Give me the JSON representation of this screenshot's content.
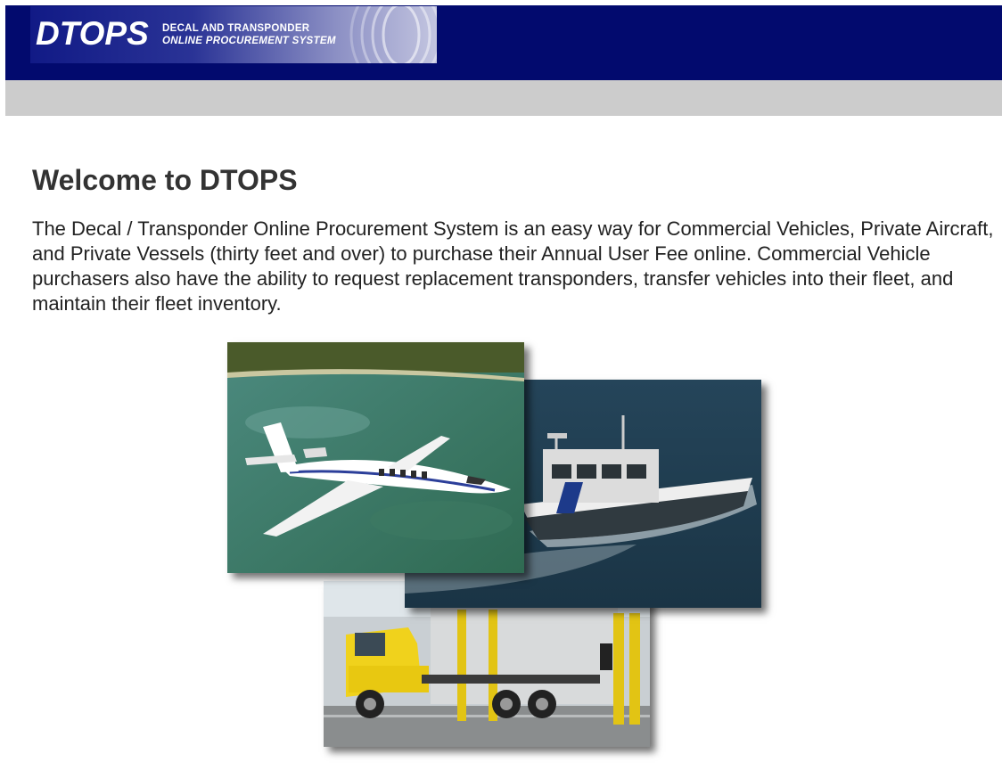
{
  "header": {
    "logo": {
      "mark": "DTOPS",
      "subtitle_line1": "DECAL AND TRANSPONDER",
      "subtitle_line2": "ONLINE PROCUREMENT SYSTEM"
    }
  },
  "main": {
    "title": "Welcome to DTOPS",
    "intro": "The Decal / Transponder Online Procurement System is an easy way for Commercial Vehicles, Private Aircraft, and Private Vessels (thirty feet and over) to purchase their Annual User Fee online. Commercial Vehicle purchasers also have the ability to request replacement transponders, transfer vehicles into their fleet, and maintain their fleet inventory."
  },
  "colors": {
    "header_bg": "#020a6e",
    "nav_bar_bg": "#cccccc",
    "title_text": "#333333",
    "body_text": "#222222"
  }
}
